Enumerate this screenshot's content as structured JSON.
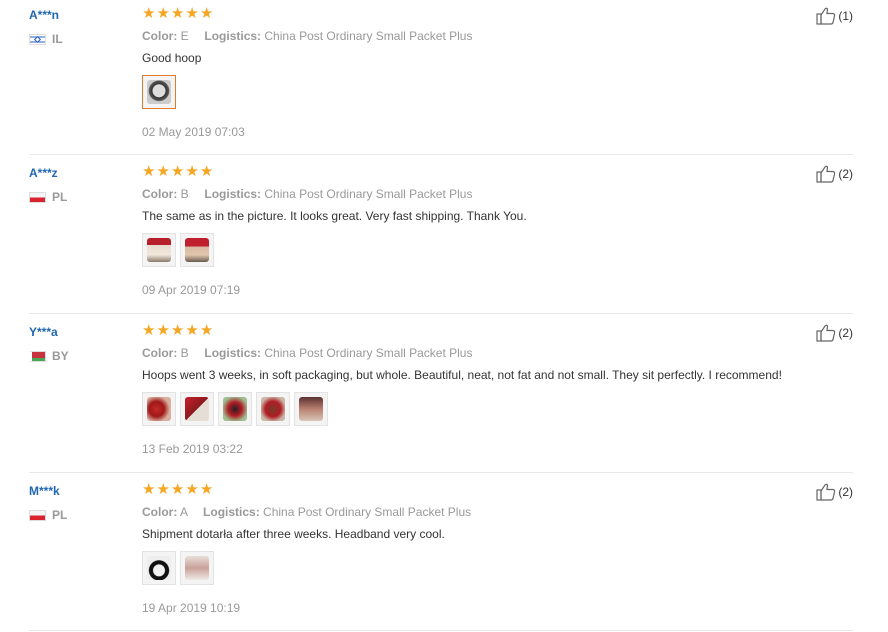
{
  "reviews": [
    {
      "user": "A***n",
      "country": "IL",
      "flag": "flag-il",
      "stars": 5,
      "color_label": "Color:",
      "color_value": "E",
      "logistics_label": "Logistics:",
      "logistics_value": "China Post Ordinary Small Packet Plus",
      "text": "Good hoop",
      "thumbs": [
        "t-hoop"
      ],
      "date": "02 May 2019 07:03",
      "helpful": "(1)"
    },
    {
      "user": "A***z",
      "country": "PL",
      "flag": "flag-pl",
      "stars": 5,
      "color_label": "Color:",
      "color_value": "B",
      "logistics_label": "Logistics:",
      "logistics_value": "China Post Ordinary Small Packet Plus",
      "text": "The same as in the picture. It looks great. Very fast shipping. Thank You.",
      "thumbs": [
        "t-face1",
        "t-face2"
      ],
      "date": "09 Apr 2019 07:19",
      "helpful": "(2)"
    },
    {
      "user": "Y***a",
      "country": "BY",
      "flag": "flag-by",
      "stars": 5,
      "color_label": "Color:",
      "color_value": "B",
      "logistics_label": "Logistics:",
      "logistics_value": "China Post Ordinary Small Packet Plus",
      "text": "Hoops went 3 weeks, in soft packaging, but whole. Beautiful, neat, not fat and not small. They sit perfectly. I recommend!",
      "thumbs": [
        "t-red1",
        "t-red2",
        "t-red3",
        "t-red4",
        "t-face3"
      ],
      "date": "13 Feb 2019 03:22",
      "helpful": "(2)"
    },
    {
      "user": "M***k",
      "country": "PL",
      "flag": "flag-pl",
      "stars": 5,
      "color_label": "Color:",
      "color_value": "A",
      "logistics_label": "Logistics:",
      "logistics_value": "China Post Ordinary Small Packet Plus",
      "text": "Shipment dotarła after three weeks. Headband very cool.",
      "thumbs": [
        "t-black",
        "t-pers"
      ],
      "date": "19 Apr 2019 10:19",
      "helpful": "(2)"
    }
  ],
  "colors": {
    "username": "#2066b0",
    "star": "#f5a623",
    "muted": "#999999",
    "active_thumb_border": "#e07c30"
  },
  "icons": {
    "star": "star-icon",
    "thumbs_up": "thumbs-up-icon"
  }
}
